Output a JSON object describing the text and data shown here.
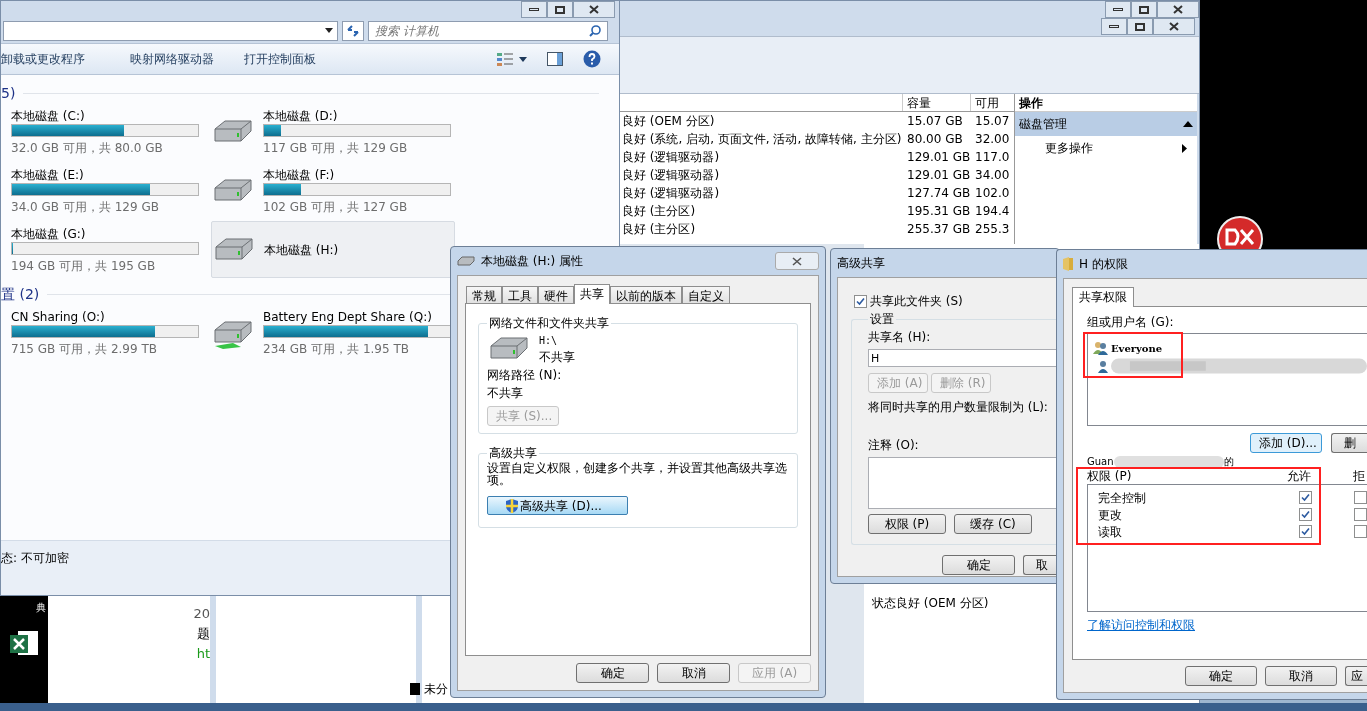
{
  "disk_management": {
    "columns": [
      {
        "label": "容量"
      },
      {
        "label": "可用"
      }
    ],
    "rows": [
      {
        "status": "良好 (OEM 分区)",
        "capacity": "15.07 GB",
        "free": "15.07"
      },
      {
        "status": "良好 (系统, 启动, 页面文件, 活动, 故障转储, 主分区)",
        "capacity": "80.00 GB",
        "free": "32.00"
      },
      {
        "status": "良好 (逻辑驱动器)",
        "capacity": "129.01 GB",
        "free": "117.0"
      },
      {
        "status": "良好 (逻辑驱动器)",
        "capacity": "129.01 GB",
        "free": "34.00"
      },
      {
        "status": "良好 (逻辑驱动器)",
        "capacity": "127.74 GB",
        "free": "102.0"
      },
      {
        "status": "良好 (主分区)",
        "capacity": "195.31 GB",
        "free": "194.4"
      },
      {
        "status": "良好 (主分区)",
        "capacity": "255.37 GB",
        "free": "255.3"
      }
    ],
    "actions": {
      "header": "操作",
      "section": "磁盘管理",
      "expanded": true,
      "items": [
        "更多操作"
      ]
    },
    "lower_status": "状态良好 (OEM 分区)",
    "legend": "未分"
  },
  "explorer": {
    "search_placeholder": "搜索 计算机",
    "toolbar": [
      "卸载或更改程序",
      "映射网络驱动器",
      "打开控制面板"
    ],
    "groups": [
      {
        "heading": "5)",
        "drives": [
          {
            "name": "本地磁盘 (C:)",
            "level": 0.6,
            "reading": "32.0 GB 可用，共 80.0 GB",
            "selected": false
          },
          {
            "kind": "local",
            "name": "本地磁盘 (D:)",
            "level": 0.09,
            "reading": "117 GB 可用，共 129 GB",
            "selected": false
          },
          {
            "name": "本地磁盘 (E:)",
            "level": 0.74,
            "reading": "34.0 GB 可用，共 129 GB",
            "selected": false
          },
          {
            "kind": "local",
            "name": "本地磁盘 (F:)",
            "level": 0.2,
            "reading": "102 GB 可用，共 127 GB",
            "selected": false
          },
          {
            "name": "本地磁盘 (G:)",
            "level": 0.005,
            "reading": "194 GB 可用，共 195 GB",
            "selected": false
          },
          {
            "kind": "local",
            "name": "本地磁盘 (H:)",
            "selected": true
          }
        ]
      },
      {
        "heading": "置 (2)",
        "drives": [
          {
            "name": "CN Sharing (O:)",
            "level": 0.77,
            "reading": "715 GB 可用，共 2.99 TB",
            "selected": false
          },
          {
            "kind": "network",
            "name": "Battery Eng Dept Share (Q:)",
            "level": 0.88,
            "reading": "234 GB 可用，共 1.95 TB",
            "selected": false
          }
        ]
      }
    ],
    "status": "态: 不可加密"
  },
  "background_fragments": [
    "典",
    "20",
    "题",
    "ht"
  ],
  "properties": {
    "title": "本地磁盘 (H:) 属性",
    "tabs": [
      {
        "label": "常规",
        "selected": false
      },
      {
        "label": "工具",
        "selected": false
      },
      {
        "label": "硬件",
        "selected": false
      },
      {
        "label": "共享",
        "selected": true
      },
      {
        "label": "以前的版本",
        "selected": false
      },
      {
        "label": "自定义",
        "selected": false
      }
    ],
    "network_group": {
      "title": "网络文件和文件夹共享",
      "path": "H:\\",
      "state": "不共享",
      "path_label": "网络路径 (N):",
      "path_value": "不共享",
      "share_button": {
        "label": "共享 (S)...",
        "disabled": true
      }
    },
    "advanced_group": {
      "title": "高级共享",
      "description": "设置自定义权限，创建多个共享，并设置其他高级共享选项。",
      "button": "高级共享 (D)..."
    },
    "buttons": [
      {
        "label": "确定",
        "disabled": false
      },
      {
        "label": "取消",
        "disabled": false
      },
      {
        "label": "应用 (A)",
        "disabled": true
      }
    ]
  },
  "advanced_sharing": {
    "title": "高级共享",
    "share_checkbox": {
      "label": "共享此文件夹 (S)",
      "checked": true
    },
    "settings_title": "设置",
    "share_name_label": "共享名 (H):",
    "share_name": "H",
    "name_buttons": [
      {
        "label": "添加 (A)",
        "disabled": true
      },
      {
        "label": "删除 (R)",
        "disabled": true
      }
    ],
    "limit_label": "将同时共享的用户数量限制为 (L):",
    "comment_label": "注释 (O):",
    "buttons": [
      {
        "label": "权限 (P)"
      },
      {
        "label": "缓存 (C)"
      }
    ],
    "footer": [
      {
        "label": "确定"
      },
      {
        "label": "取"
      }
    ]
  },
  "permissions": {
    "title": "H 的权限",
    "tab": {
      "label": "共享权限",
      "selected": true
    },
    "users_label": "组或用户名 (G):",
    "users": [
      {
        "kind": "group",
        "name": "Everyone"
      },
      {
        "kind": "redacted"
      }
    ],
    "user_buttons": [
      {
        "label": "添加 (D)...",
        "focused": true
      },
      {
        "label": "删",
        "focused": false
      }
    ],
    "perm_caption": [
      "Guan",
      "的"
    ],
    "columns": [
      "权限 (P)",
      "允许",
      "拒"
    ],
    "rows": [
      {
        "name": "完全控制",
        "allow": true,
        "deny": false
      },
      {
        "name": "更改",
        "allow": true,
        "deny": false
      },
      {
        "name": "读取",
        "allow": true,
        "deny": false
      }
    ],
    "link": "了解访问控制和权限",
    "buttons": [
      {
        "label": "确定"
      },
      {
        "label": "取消"
      },
      {
        "label": "应"
      }
    ]
  }
}
